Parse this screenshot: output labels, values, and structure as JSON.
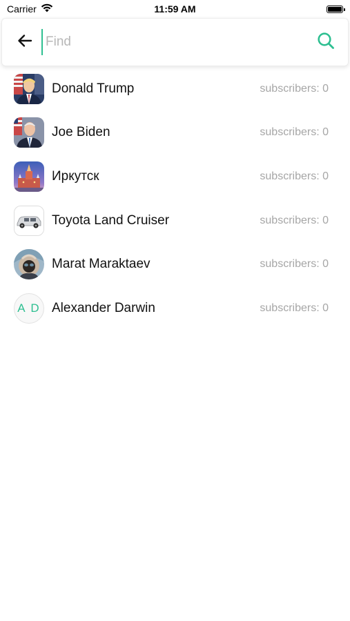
{
  "status_bar": {
    "carrier": "Carrier",
    "time": "11:59 AM"
  },
  "search": {
    "placeholder": "Find",
    "value": "",
    "accent_color": "#2ebf91"
  },
  "results": [
    {
      "name": "Donald Trump",
      "subscribers_label": "subscribers: 0",
      "avatar": "photo"
    },
    {
      "name": "Joe Biden",
      "subscribers_label": "subscribers: 0",
      "avatar": "photo"
    },
    {
      "name": "Иркутск",
      "subscribers_label": "subscribers: 0",
      "avatar": "photo"
    },
    {
      "name": "Toyota Land Cruiser",
      "subscribers_label": "subscribers: 0",
      "avatar": "photo"
    },
    {
      "name": "Marat Maraktaev",
      "subscribers_label": "subscribers: 0",
      "avatar": "photo"
    },
    {
      "name": "Alexander Darwin",
      "subscribers_label": "subscribers: 0",
      "avatar": "initials",
      "initials": "A D"
    }
  ],
  "icons": {
    "back": "arrow-left-icon",
    "search": "search-icon",
    "wifi": "wifi-icon",
    "battery": "battery-icon"
  }
}
